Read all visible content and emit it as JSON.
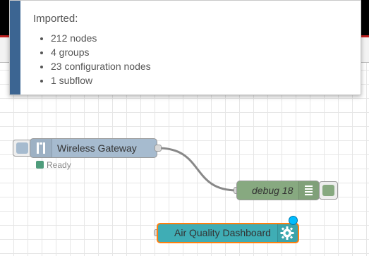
{
  "notification": {
    "title": "Imported:",
    "items": [
      "212 nodes",
      "4 groups",
      "23 configuration nodes",
      "1 subflow"
    ]
  },
  "nodes": {
    "gateway": {
      "label": "Wireless Gateway",
      "status": "Ready",
      "icon": "bridge-icon",
      "color": "#a6bbcf",
      "status_color": "#4e9c7b"
    },
    "debug": {
      "label": "debug 18",
      "icon": "list-icon",
      "color": "#87a980"
    },
    "dashboard": {
      "label": "Air Quality Dashboard",
      "icon": "gear-icon",
      "color": "#3fadb5",
      "selected_color": "#ff7f0e",
      "changed_color": "#00bcff"
    }
  },
  "colors": {
    "header": "#000000",
    "accent_red": "#c02020",
    "notification_accent": "#3c6592",
    "wire": "#888888"
  }
}
